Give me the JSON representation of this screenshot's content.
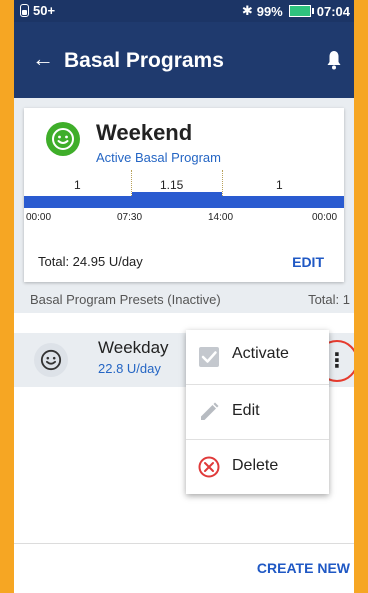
{
  "status_bar": {
    "left_text": "50+",
    "battery_percent": "99%",
    "time": "07:04",
    "battery_color": "#2ec27e"
  },
  "app_bar": {
    "title": "Basal Programs",
    "back_icon": "arrow-left-icon",
    "notification_icon": "bell-icon",
    "background": "#1f3a6e"
  },
  "active_program": {
    "name": "Weekend",
    "subtitle": "Active Basal Program",
    "icon": "smiley-icon",
    "icon_color": "#3fae2a",
    "segments": [
      {
        "rate": "1",
        "start": "00:00",
        "end": "07:30"
      },
      {
        "rate": "1.15",
        "start": "07:30",
        "end": "14:00"
      },
      {
        "rate": "1",
        "start": "14:00",
        "end": "00:00"
      }
    ],
    "time_labels": [
      "00:00",
      "07:30",
      "14:00",
      "00:00"
    ],
    "total": "Total: 24.95 U/day",
    "edit_label": "EDIT"
  },
  "presets": {
    "header_label": "Basal Program Presets (Inactive)",
    "header_total": "Total: 1",
    "items": [
      {
        "name": "Weekday",
        "rate": "22.8 U/day",
        "icon": "smiley-icon"
      }
    ]
  },
  "context_menu": {
    "items": [
      {
        "label": "Activate",
        "icon": "checkbox-icon"
      },
      {
        "label": "Edit",
        "icon": "pencil-icon"
      },
      {
        "label": "Delete",
        "icon": "delete-circle-icon"
      }
    ]
  },
  "footer": {
    "create_new_label": "CREATE NEW"
  },
  "colors": {
    "accent_blue": "#1f58c4",
    "highlight_ring": "#e63b2e",
    "frame_orange": "#f6a623"
  }
}
